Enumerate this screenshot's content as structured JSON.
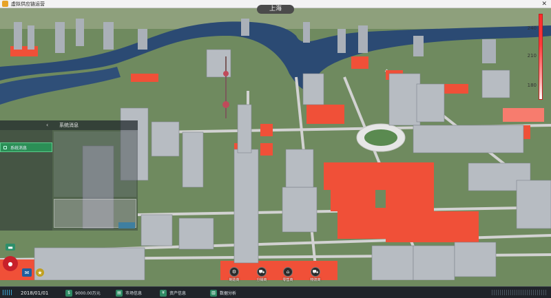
{
  "window": {
    "title": "虚拟供应链运营",
    "close_glyph": "✕"
  },
  "city": "上海",
  "scale": {
    "labels": [
      "240",
      "210",
      "180"
    ]
  },
  "message_panel": {
    "title": "系统消息",
    "collapse_glyph": "‹",
    "tab_label": "系统消息",
    "input_placeholder": "",
    "send_label": ""
  },
  "stations": [
    {
      "label": "制造商",
      "icon": "factory-icon",
      "glyph": "⚙"
    },
    {
      "label": "分销商",
      "icon": "distributor-icon",
      "glyph": "⛟"
    },
    {
      "label": "零售商",
      "icon": "shop-icon",
      "glyph": "⌂"
    },
    {
      "label": "物流商",
      "icon": "truck-icon",
      "glyph": "⛟"
    }
  ],
  "bottombar": {
    "date": "2018/01/01",
    "funds": "9000.00万元",
    "market_label": "市场信息",
    "asset_label": "资产信息",
    "data_label": "数据分析"
  },
  "colors": {
    "water": "#2b4a73",
    "grass": "#6f8a5f",
    "lot": "#f05038",
    "road": "#c8c8c8"
  }
}
